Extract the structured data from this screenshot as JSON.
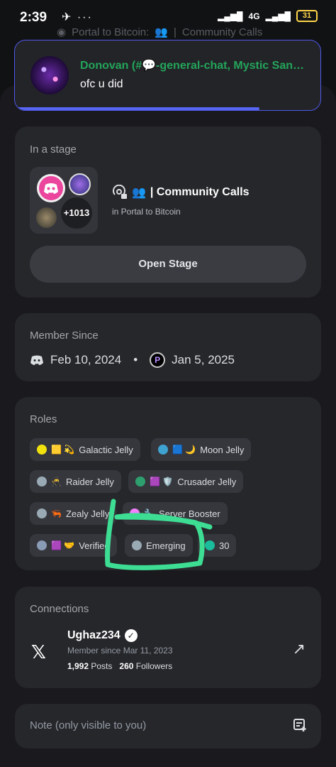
{
  "status_bar": {
    "time": "2:39",
    "left_icons": "✈ ···",
    "network": "4G",
    "battery": "31"
  },
  "background_channel": {
    "server": "Portal to Bitcoin:",
    "emoji": "👥",
    "name": "Community Calls"
  },
  "notification": {
    "author": "Donovan (#💬-general-chat, Mystic Sanctum...",
    "message": "ofc u did"
  },
  "stage": {
    "section_title": "In a stage",
    "more_count": "+1013",
    "channel_name": "| Community Calls",
    "channel_emoji": "👥",
    "server_line": "in Portal to Bitcoin",
    "open_button": "Open Stage"
  },
  "member_since": {
    "title": "Member Since",
    "discord_date": "Feb 10, 2024",
    "separator": "•",
    "server_date": "Jan 5, 2025",
    "server_initial": "P"
  },
  "roles": {
    "title": "Roles",
    "items": [
      {
        "color": "#f1e20e",
        "emoji": "🟨 💫",
        "label": "Galactic Jelly"
      },
      {
        "color": "#3ea3d1",
        "emoji": "🟦 🌙",
        "label": "Moon Jelly"
      },
      {
        "color": "#99aab5",
        "emoji": "🥷",
        "label": "Raider Jelly"
      },
      {
        "color": "#2e9f6f",
        "emoji": "🟪 🛡️",
        "label": "Crusader Jelly"
      },
      {
        "color": "#99aab5",
        "emoji": "🦐",
        "label": "Zealy Jelly"
      },
      {
        "color": "#f47fff",
        "emoji": "🔧",
        "label": "Server Booster"
      },
      {
        "color": "#8a9bb5",
        "emoji": "🟪 🤝",
        "label": "Verified"
      },
      {
        "color": "#99aab5",
        "emoji": "",
        "label": "Emerging"
      },
      {
        "color": "#1abc9c",
        "emoji": "",
        "label": "30"
      }
    ]
  },
  "connections": {
    "title": "Connections",
    "username": "Ughaz234",
    "since": "Member since Mar 11, 2023",
    "posts_count": "1,992",
    "posts_label": "Posts",
    "followers_count": "260",
    "followers_label": "Followers"
  },
  "note": {
    "placeholder": "Note (only visible to you)"
  },
  "colors": {
    "accent": "#5865f2",
    "online_green": "#23a55a",
    "annotation_scribble": "#3dde94"
  }
}
